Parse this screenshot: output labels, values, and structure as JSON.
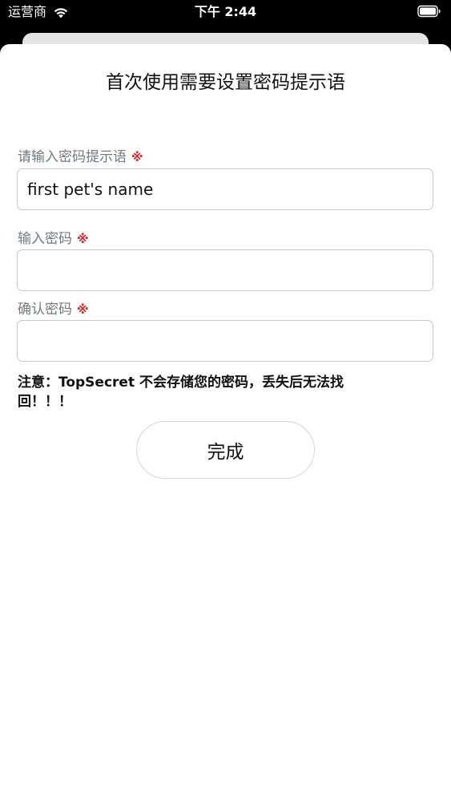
{
  "status_bar": {
    "carrier": "运营商",
    "time": "下午 2:44",
    "wifi_icon": "wifi-icon",
    "battery_icon": "battery-icon"
  },
  "sheet": {
    "title": "首次使用需要设置密码提示语",
    "required_mark": "※",
    "hint_field": {
      "label": "请输入密码提示语",
      "value": "first pet's name",
      "placeholder": ""
    },
    "password_field": {
      "label": "输入密码",
      "value": "",
      "placeholder": ""
    },
    "confirm_field": {
      "label": "确认密码",
      "value": "",
      "placeholder": ""
    },
    "note": "注意：TopSecret 不会存储您的密码，丢失后无法找回！！！",
    "done_label": "完成"
  },
  "colors": {
    "label": "#6f7a82",
    "required": "#d6252b",
    "border": "#c9c9cc",
    "back_card": "#e4e4e6"
  }
}
